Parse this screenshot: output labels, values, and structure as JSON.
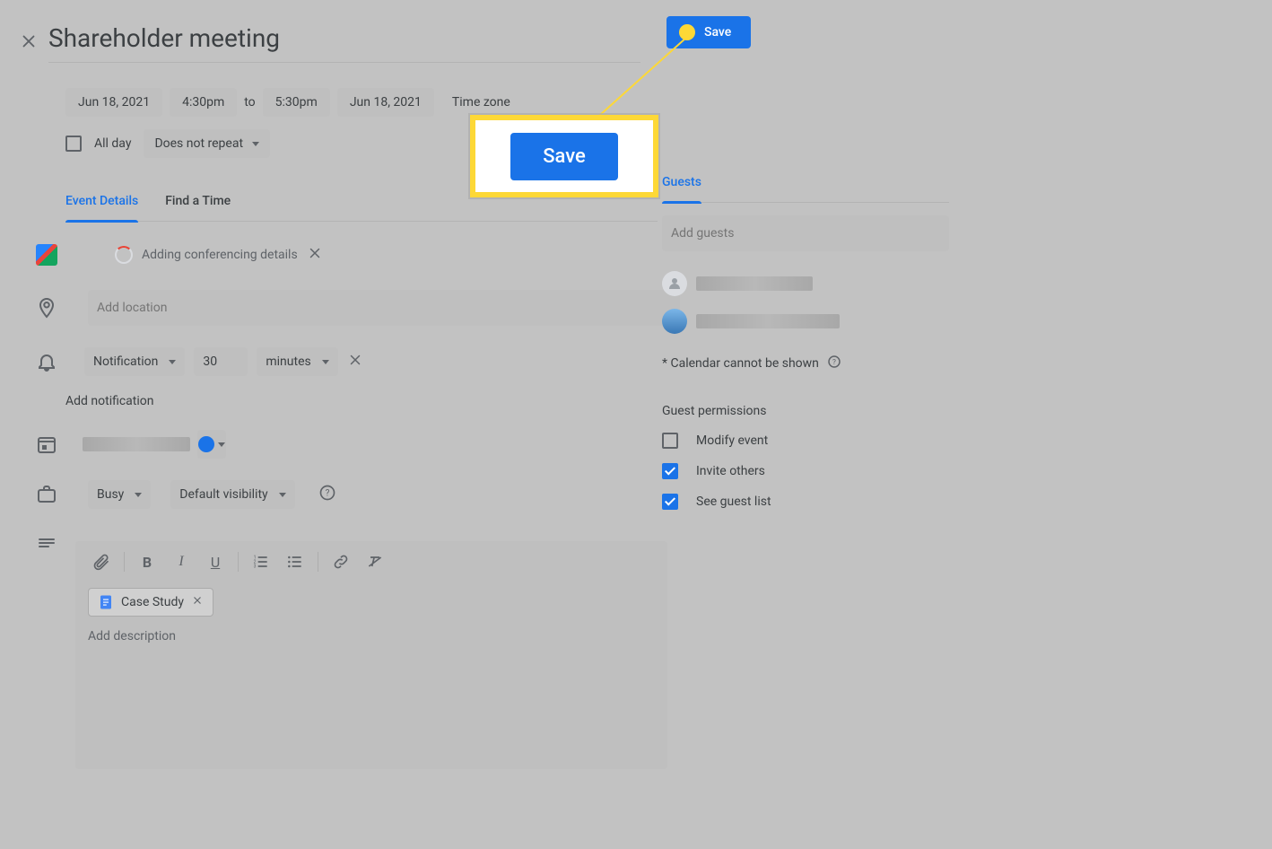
{
  "event": {
    "title": "Shareholder meeting",
    "start_date": "Jun 18, 2021",
    "start_time": "4:30pm",
    "to_label": "to",
    "end_time": "5:30pm",
    "end_date": "Jun 18, 2021",
    "timezone_label": "Time zone",
    "all_day_label": "All day",
    "all_day_checked": false,
    "repeat_label": "Does not repeat"
  },
  "save_button": "Save",
  "callout_save": "Save",
  "tabs": {
    "event_details": "Event Details",
    "find_a_time": "Find a Time",
    "guests": "Guests"
  },
  "conferencing": {
    "status": "Adding conferencing details"
  },
  "location": {
    "placeholder": "Add location"
  },
  "notification": {
    "type": "Notification",
    "value": "30",
    "unit": "minutes",
    "add_label": "Add notification"
  },
  "owner": {
    "color_hex": "#1a73e8"
  },
  "availability": {
    "busy": "Busy",
    "visibility": "Default visibility"
  },
  "description": {
    "attachment": "Case Study",
    "placeholder": "Add description"
  },
  "guests": {
    "placeholder": "Add guests",
    "calendar_note": "* Calendar cannot be shown",
    "permissions_title": "Guest permissions",
    "perm_modify": {
      "label": "Modify event",
      "checked": false
    },
    "perm_invite": {
      "label": "Invite others",
      "checked": true
    },
    "perm_see": {
      "label": "See guest list",
      "checked": true
    }
  }
}
